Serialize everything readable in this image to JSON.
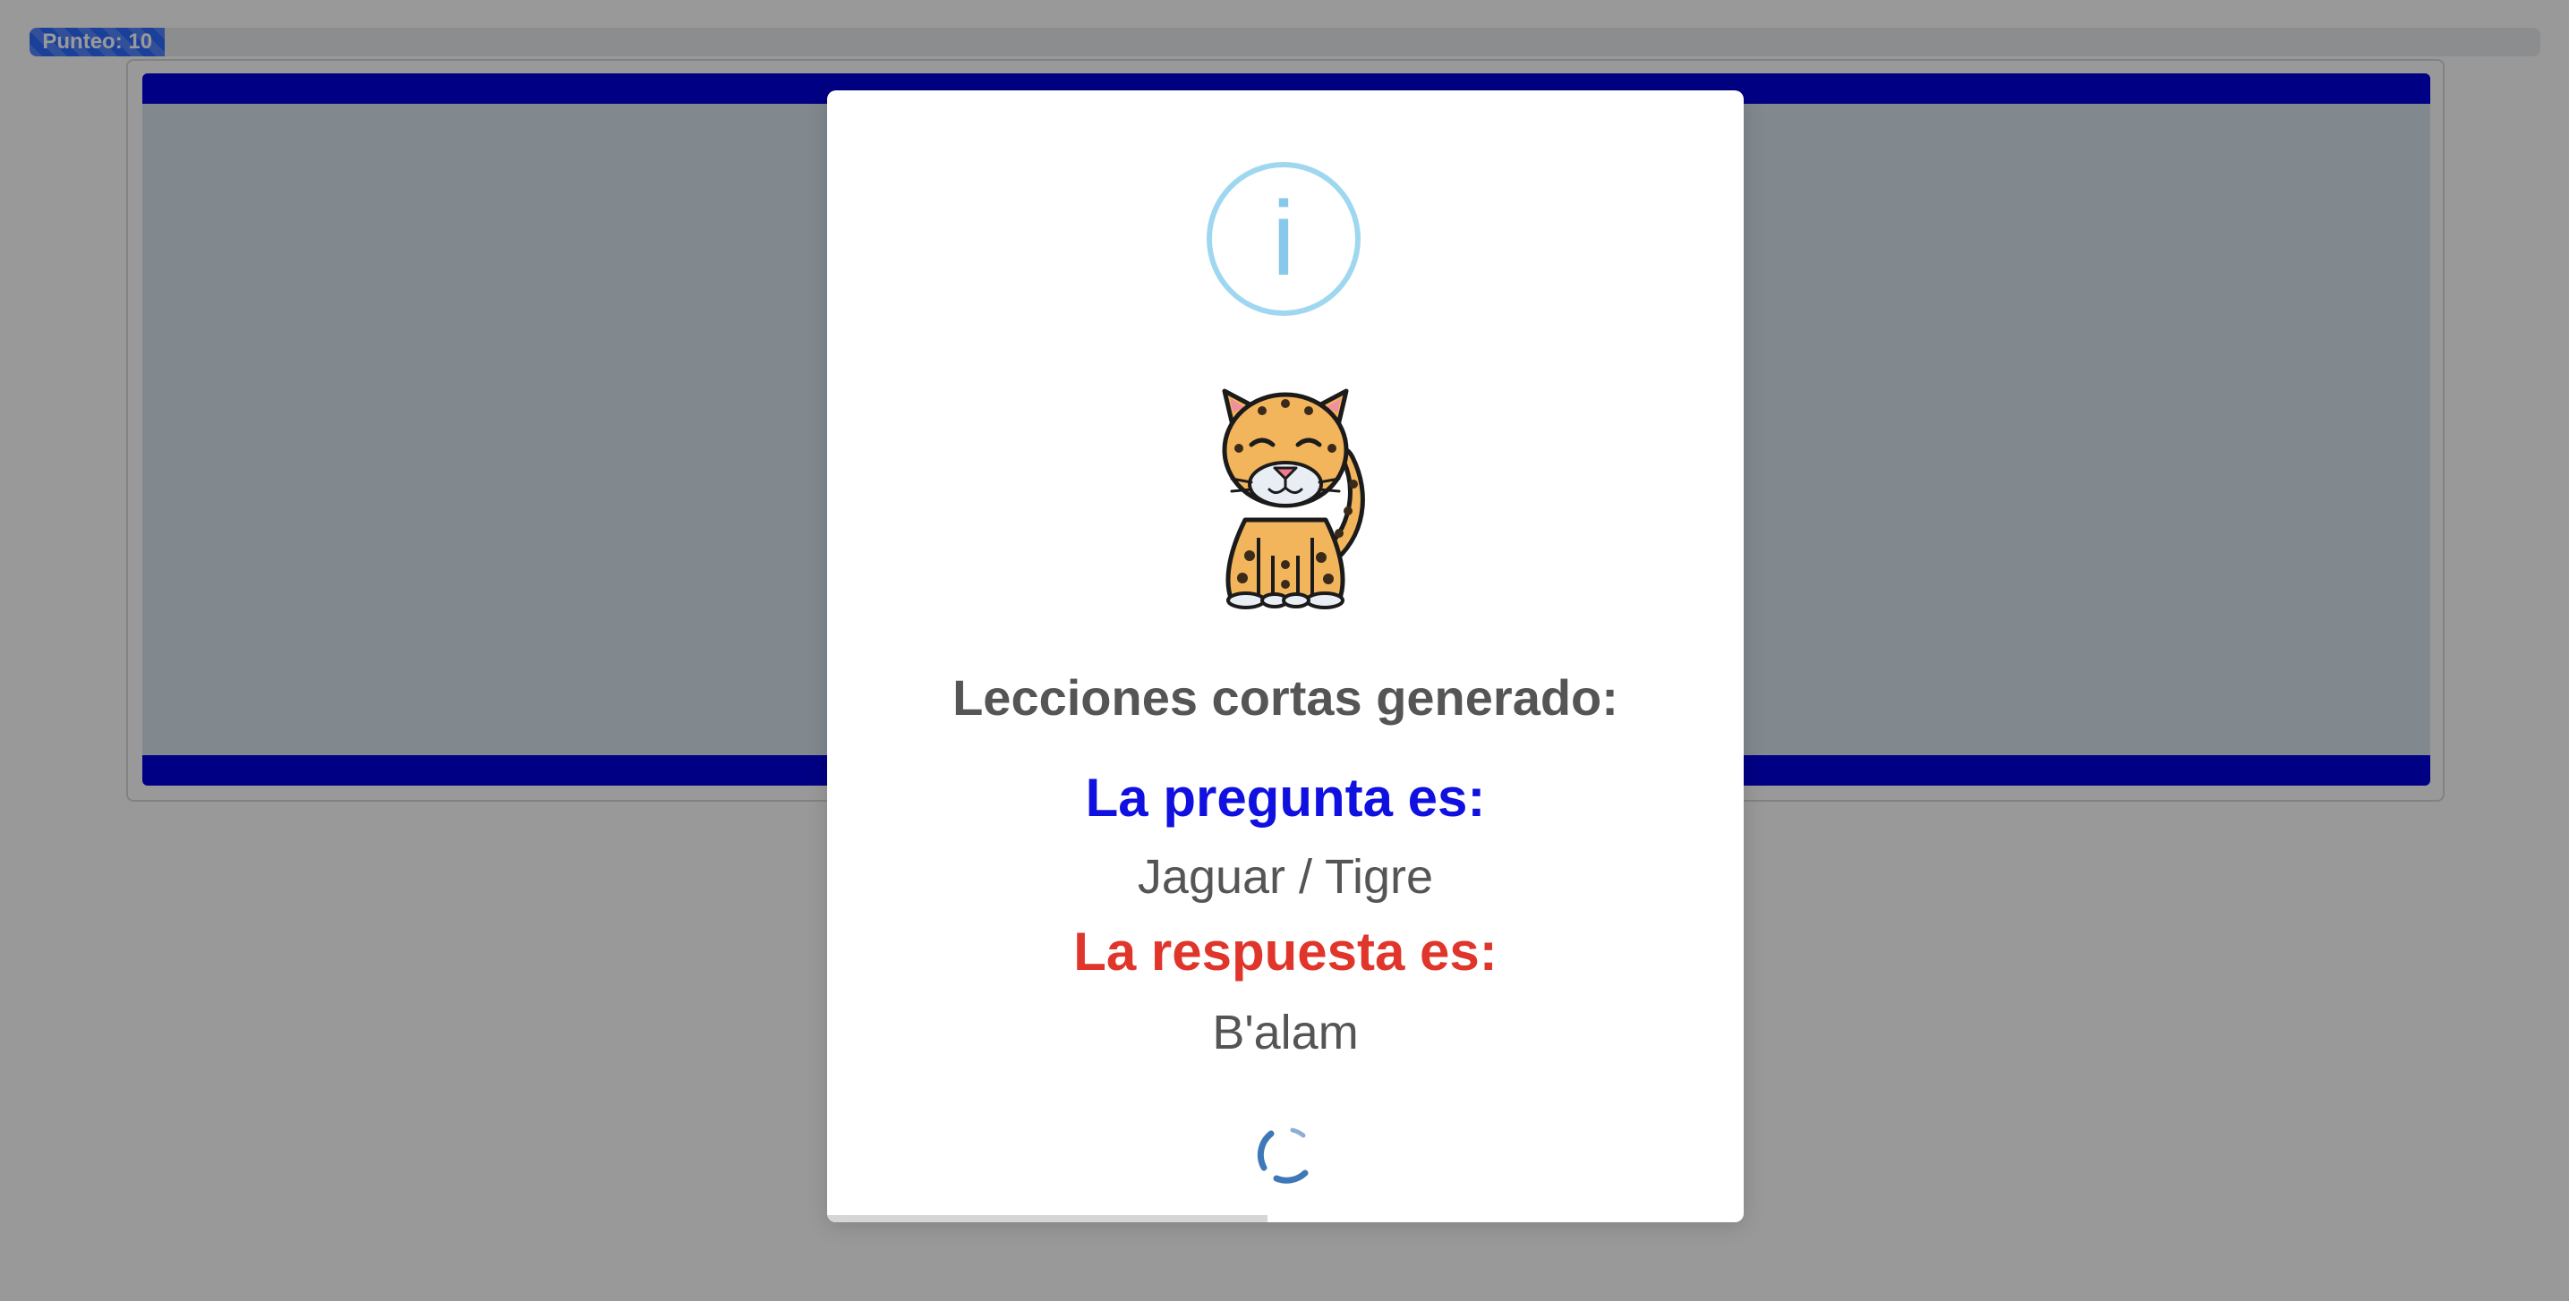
{
  "score": {
    "label": "Punteo: 10",
    "progress_fraction": 0.054
  },
  "modal": {
    "icon": "info-icon",
    "image": "jaguar-icon",
    "title": "Lecciones cortas generado:",
    "question_label": "La pregunta es:",
    "question_value": "Jaguar / Tigre",
    "answer_label": "La respuesta es:",
    "answer_value": "B'alam",
    "loading": true,
    "timer_fraction": 0.48
  },
  "colors": {
    "score_fill": "#2e6bff",
    "game_bar": "#0000dd",
    "question_label": "#1010e0",
    "answer_label": "#e0352b",
    "info_icon": "#87c9ea",
    "loader": "#3f78b8"
  }
}
